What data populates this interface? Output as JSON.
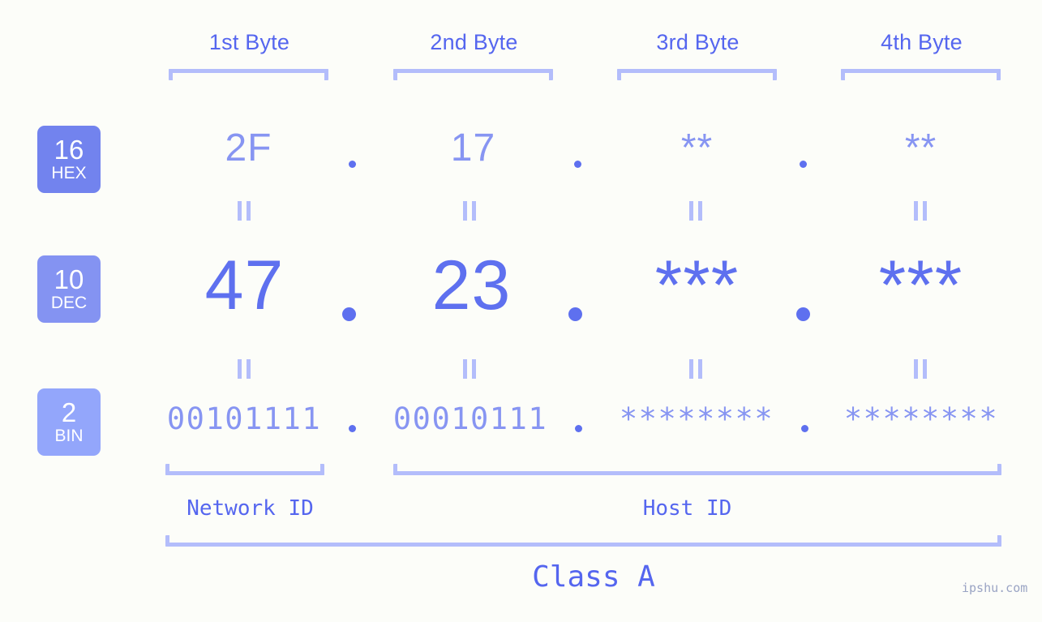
{
  "background_color": "#fcfdf9",
  "colors": {
    "header_text": "#5566ef",
    "bracket": "#b3bdfb",
    "hex_value": "#8795f2",
    "dec_value": "#5e70ef",
    "bin_value": "#8795f2",
    "badge_hex": "#7283ee",
    "badge_dec": "#8493f2",
    "badge_bin": "#93a6fb",
    "watermark": "#9aa4c4"
  },
  "byte_headers": [
    {
      "label": "1st Byte"
    },
    {
      "label": "2nd Byte"
    },
    {
      "label": "3rd Byte"
    },
    {
      "label": "4th Byte"
    }
  ],
  "bases": [
    {
      "num": "16",
      "abbr": "HEX"
    },
    {
      "num": "10",
      "abbr": "DEC"
    },
    {
      "num": "2",
      "abbr": "BIN"
    }
  ],
  "rows": {
    "hex": {
      "base": "16",
      "name": "HEX",
      "values": [
        "2F",
        "17",
        "**",
        "**"
      ],
      "separator": "."
    },
    "dec": {
      "base": "10",
      "name": "DEC",
      "values": [
        "47",
        "23",
        "***",
        "***"
      ],
      "separator": "."
    },
    "bin": {
      "base": "2",
      "name": "BIN",
      "values": [
        "00101111",
        "00010111",
        "********",
        "********"
      ],
      "separator": "."
    }
  },
  "equivalence_marker": "=",
  "sections": [
    {
      "label": "Network ID"
    },
    {
      "label": "Host ID"
    }
  ],
  "class": {
    "label": "Class A"
  },
  "watermark": {
    "text": "ipshu.com"
  }
}
